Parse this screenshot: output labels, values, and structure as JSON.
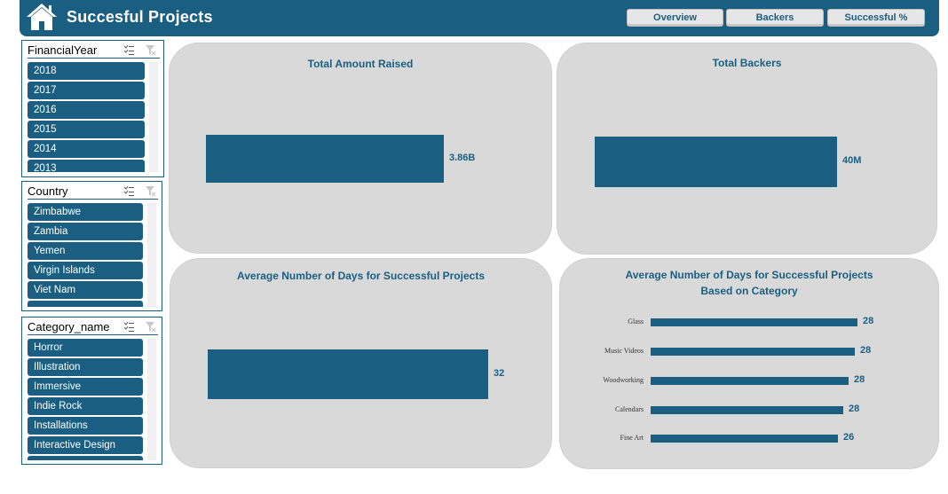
{
  "header": {
    "title": "Succesful Projects",
    "nav": [
      "Overview",
      "Backers",
      "Successful %"
    ]
  },
  "slicers": {
    "financial_year": {
      "title": "FinancialYear",
      "items": [
        "2018",
        "2017",
        "2016",
        "2015",
        "2014",
        "2013"
      ]
    },
    "country": {
      "title": "Country",
      "items": [
        "Zimbabwe",
        "Zambia",
        "Yemen",
        "Virgin Islands",
        "Viet Nam"
      ]
    },
    "category": {
      "title": "Category_name",
      "items": [
        "Horror",
        "Illustration",
        "Immersive",
        "Indie Rock",
        "Installations",
        "Interactive Design"
      ]
    }
  },
  "colors": {
    "brand": "#1a5f82",
    "card": "#d9d9d9",
    "button": "#e6e6e6"
  },
  "cards": {
    "total_amount": {
      "title": "Total Amount Raised",
      "value_label": "3.86B"
    },
    "total_backers": {
      "title": "Total Backers",
      "value_label": "40M"
    },
    "avg_days": {
      "title": "Average Number of Days for Successful Projects",
      "value_label": "32"
    },
    "avg_days_category": {
      "title_line1": "Average Number of Days for Successful Projects",
      "title_line2": "Based on Category"
    }
  },
  "chart_data": [
    {
      "type": "bar",
      "title": "Total Amount Raised",
      "categories": [
        ""
      ],
      "values": [
        3860000000
      ],
      "data_labels": [
        "3.86B"
      ]
    },
    {
      "type": "bar",
      "title": "Total Backers",
      "categories": [
        ""
      ],
      "values": [
        40000000
      ],
      "data_labels": [
        "40M"
      ]
    },
    {
      "type": "bar",
      "title": "Average Number of Days for Successful Projects",
      "categories": [
        ""
      ],
      "values": [
        32
      ],
      "data_labels": [
        "32"
      ]
    },
    {
      "type": "bar",
      "orientation": "horizontal",
      "title": "Average Number of Days for Successful Projects Based on Category",
      "categories": [
        "Glass",
        "Music Videos",
        "Woodworking",
        "Calendars",
        "Fine Art"
      ],
      "values": [
        28.6,
        28.2,
        27.4,
        26.6,
        25.9
      ],
      "data_labels": [
        "28",
        "28",
        "28",
        "28",
        "26"
      ]
    }
  ]
}
